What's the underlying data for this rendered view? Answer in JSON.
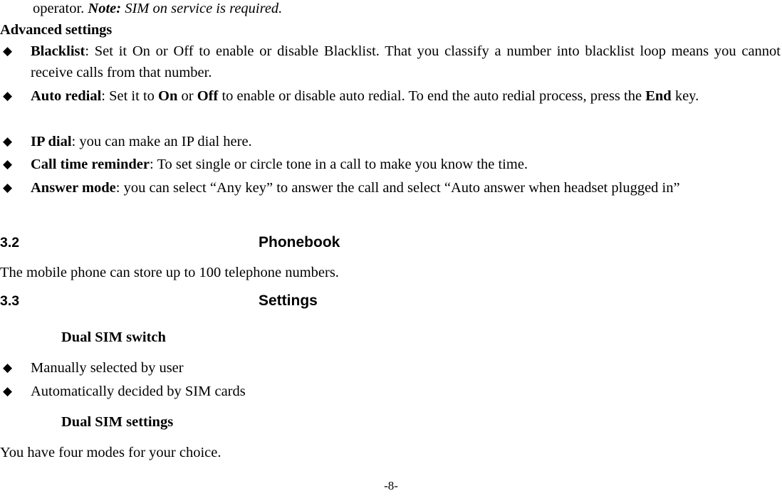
{
  "document": {
    "page_number_label": "-8-",
    "bullet_glyph": "◆",
    "bullet_icon_name": "diamond-bullet-icon"
  },
  "content": {
    "continued_paragraph": {
      "lead": "operator. ",
      "note_label": "Note:",
      "note_text": " SIM on service is required."
    },
    "advanced_settings_heading": "Advanced settings",
    "advanced_settings_items": [
      {
        "term": "Blacklist",
        "rest": ": Set it On or Off to enable or disable Blacklist. That you classify a number into blacklist loop means you cannot receive calls from that number."
      },
      {
        "term": "Auto redial",
        "rest_1": ": Set it to ",
        "bold_on": "On",
        "rest_2": " or ",
        "bold_off": "Off",
        "rest_3": " to enable or disable auto redial. To end the auto redial process, press the ",
        "bold_end": "End",
        "rest_4": " key."
      },
      {
        "term": "IP dial",
        "rest": ": you can make an IP dial here."
      },
      {
        "term": "Call time reminder",
        "rest": ": To set single or circle tone in a call to make you know the time."
      },
      {
        "term": "Answer mode",
        "rest": ": you can select “Any key” to answer the call and select “Auto answer when headset plugged in”"
      }
    ],
    "section_3_2": {
      "number": "3.2",
      "title": "Phonebook",
      "body": "The mobile phone can store up to 100 telephone numbers."
    },
    "section_3_3": {
      "number": "3.3",
      "title": "Settings"
    },
    "dual_sim_switch": {
      "heading": "Dual SIM switch",
      "items": [
        "Manually selected by user",
        "Automatically decided by SIM cards"
      ]
    },
    "dual_sim_settings": {
      "heading": "Dual SIM settings",
      "body": "You have four modes for your choice."
    }
  }
}
